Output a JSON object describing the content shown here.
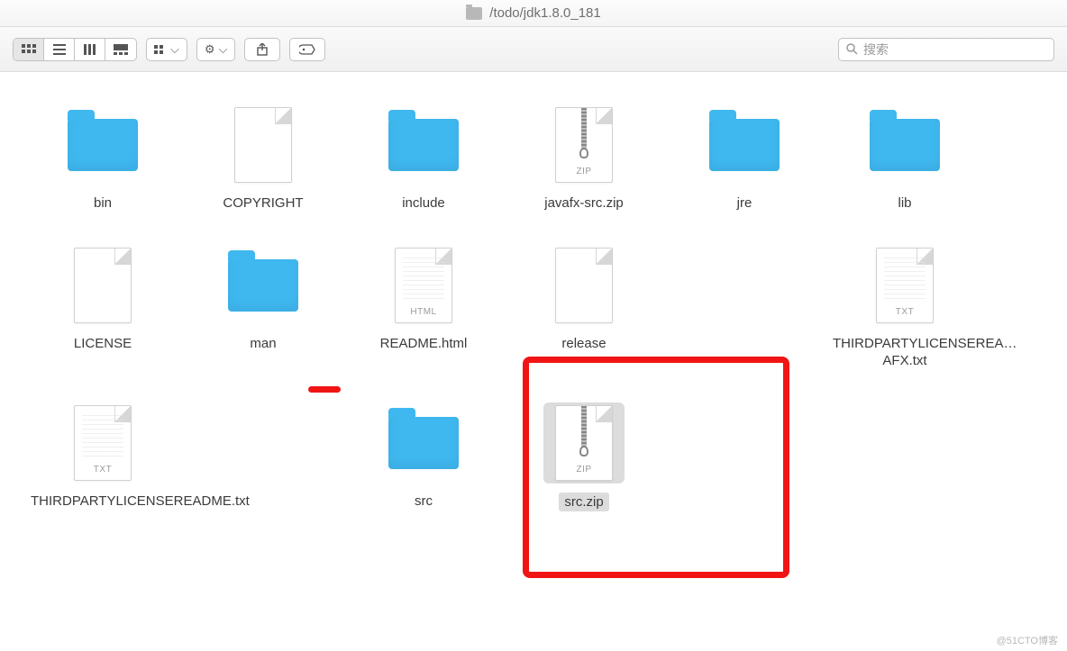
{
  "window": {
    "path": "/todo/jdk1.8.0_181"
  },
  "toolbar": {
    "search_placeholder": "搜索"
  },
  "items": [
    {
      "name": "bin",
      "type": "folder",
      "selected": false
    },
    {
      "name": "COPYRIGHT",
      "type": "file",
      "tag": "",
      "selected": false
    },
    {
      "name": "include",
      "type": "folder",
      "selected": false
    },
    {
      "name": "javafx-src.zip",
      "type": "zip",
      "tag": "ZIP",
      "selected": false
    },
    {
      "name": "jre",
      "type": "folder",
      "selected": false
    },
    {
      "name": "lib",
      "type": "folder",
      "selected": false
    },
    {
      "name": "LICENSE",
      "type": "file",
      "tag": "",
      "selected": false
    },
    {
      "name": "man",
      "type": "folder",
      "selected": false
    },
    {
      "name": "README.html",
      "type": "html",
      "tag": "HTML",
      "selected": false
    },
    {
      "name": "release",
      "type": "file",
      "tag": "",
      "selected": false
    },
    {
      "name": "",
      "type": "blank",
      "selected": false
    },
    {
      "name": "THIRDPARTYLICENSEREA…AFX.txt",
      "type": "txt",
      "tag": "TXT",
      "selected": false
    },
    {
      "name": "THIRDPARTYLICENSEREADME.txt",
      "type": "txt",
      "tag": "TXT",
      "selected": false
    },
    {
      "name": "",
      "type": "blank",
      "selected": false
    },
    {
      "name": "src",
      "type": "folder",
      "selected": false
    },
    {
      "name": "src.zip",
      "type": "zip",
      "tag": "ZIP",
      "selected": true
    }
  ],
  "watermark": "@51CTO博客"
}
